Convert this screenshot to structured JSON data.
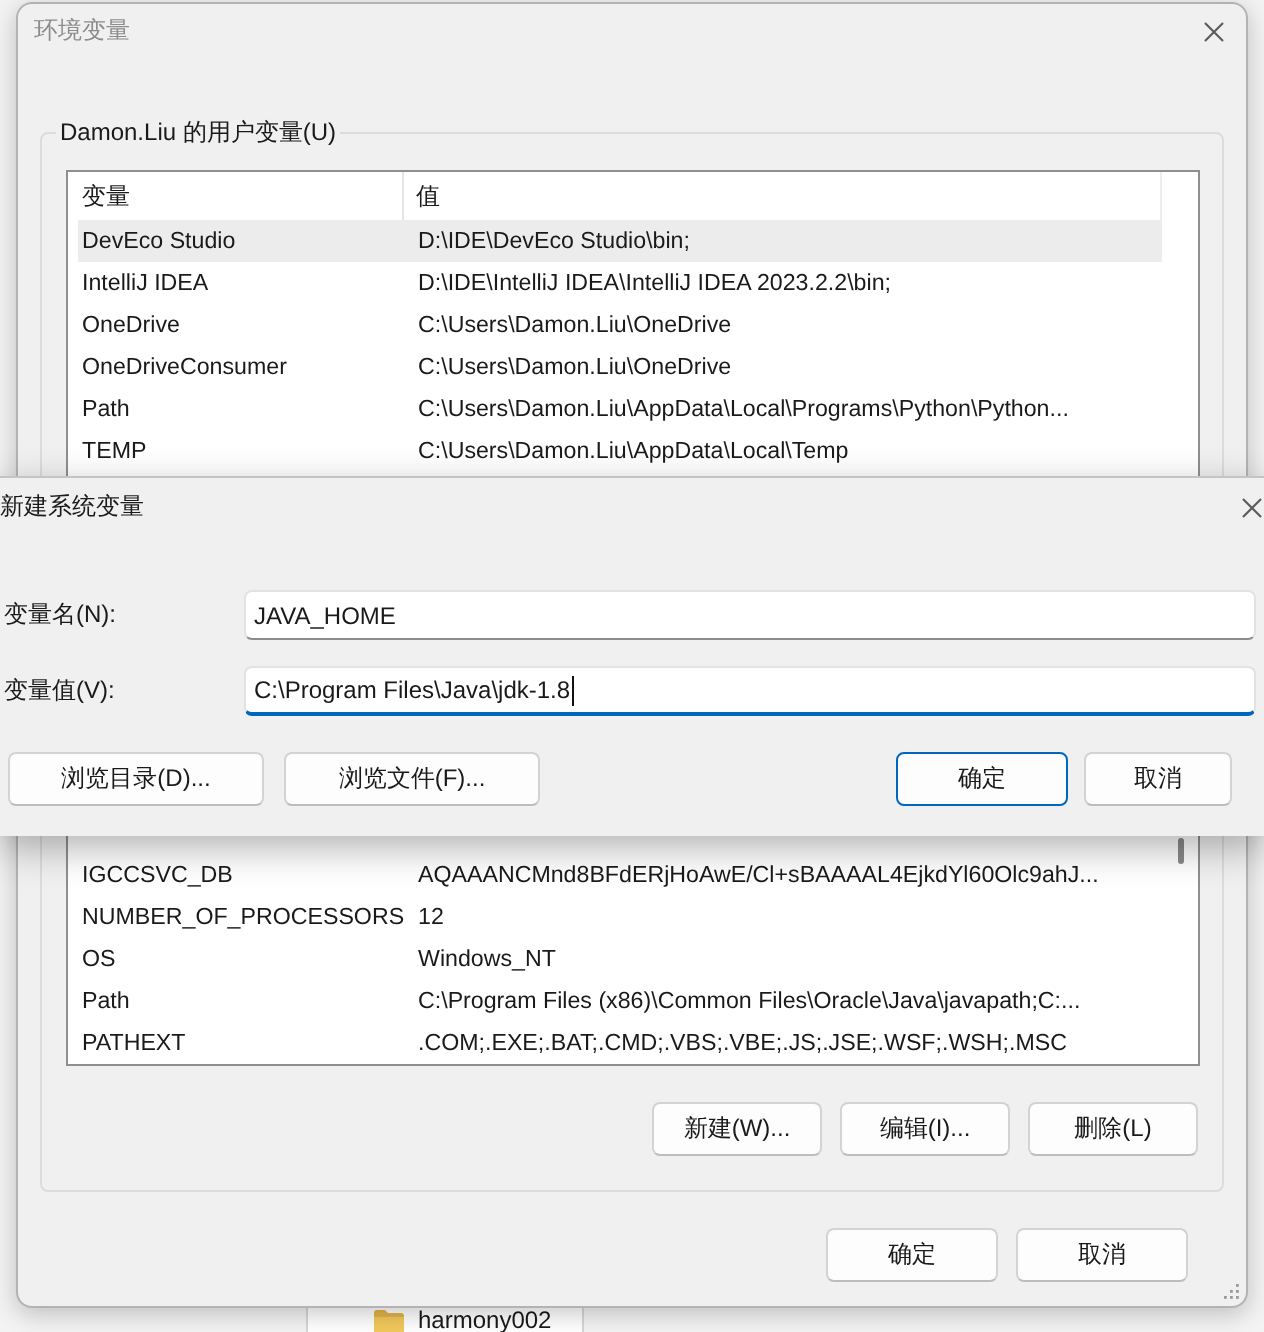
{
  "explorer": {
    "items": [
      {
        "name": "harmony002"
      }
    ]
  },
  "env_window": {
    "title": "环境变量",
    "active": false,
    "user_variables": {
      "label": "Damon.Liu 的用户变量(U)",
      "columns": [
        "变量",
        "值"
      ],
      "rows": [
        {
          "variable": "DevEco Studio",
          "value": "D:\\IDE\\DevEco Studio\\bin;",
          "selected": true
        },
        {
          "variable": "IntelliJ IDEA",
          "value": "D:\\IDE\\IntelliJ IDEA\\IntelliJ IDEA 2023.2.2\\bin;",
          "selected": false
        },
        {
          "variable": "OneDrive",
          "value": "C:\\Users\\Damon.Liu\\OneDrive",
          "selected": false
        },
        {
          "variable": "OneDriveConsumer",
          "value": "C:\\Users\\Damon.Liu\\OneDrive",
          "selected": false
        },
        {
          "variable": "Path",
          "value": "C:\\Users\\Damon.Liu\\AppData\\Local\\Programs\\Python\\Python...",
          "selected": false
        },
        {
          "variable": "TEMP",
          "value": "C:\\Users\\Damon.Liu\\AppData\\Local\\Temp",
          "selected": false
        }
      ]
    },
    "system_variables": {
      "rows": [
        {
          "variable": "IGCCSVC_DB",
          "value": "AQAAANCMnd8BFdERjHoAwE/Cl+sBAAAAL4EjkdYl60Olc9ahJ...",
          "selected": false
        },
        {
          "variable": "NUMBER_OF_PROCESSORS",
          "value": "12",
          "selected": false
        },
        {
          "variable": "OS",
          "value": "Windows_NT",
          "selected": false
        },
        {
          "variable": "Path",
          "value": "C:\\Program Files (x86)\\Common Files\\Oracle\\Java\\javapath;C:...",
          "selected": false
        },
        {
          "variable": "PATHEXT",
          "value": ".COM;.EXE;.BAT;.CMD;.VBS;.VBE;.JS;.JSE;.WSF;.WSH;.MSC",
          "selected": false
        }
      ],
      "buttons": [
        "新建(W)...",
        "编辑(I)...",
        "删除(L)"
      ]
    },
    "buttons": [
      "确定",
      "取消"
    ]
  },
  "new_variable_dialog": {
    "title": "新建系统变量",
    "active": true,
    "fields": [
      {
        "label": "变量名(N):",
        "value": "JAVA_HOME",
        "focused": false
      },
      {
        "label": "变量值(V):",
        "value": "C:\\Program Files\\Java\\jdk-1.8",
        "focused": true
      }
    ],
    "browse_buttons": [
      "浏览目录(D)...",
      "浏览文件(F)..."
    ],
    "buttons": [
      {
        "label": "确定",
        "default": true
      },
      {
        "label": "取消",
        "default": false
      }
    ]
  }
}
